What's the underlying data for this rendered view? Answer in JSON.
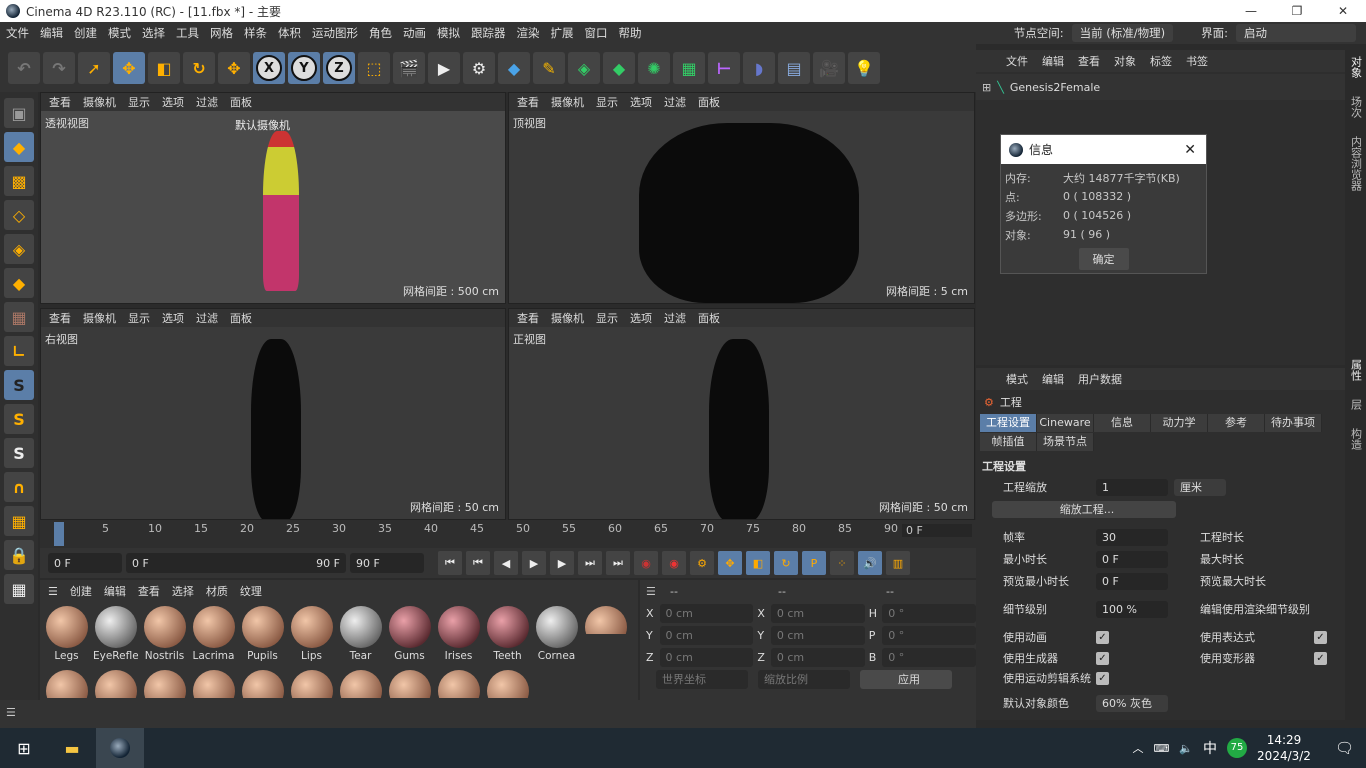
{
  "title": "Cinema 4D R23.110 (RC) - [11.fbx *] - 主要",
  "menu": [
    "文件",
    "编辑",
    "创建",
    "模式",
    "选择",
    "工具",
    "网格",
    "样条",
    "体积",
    "运动图形",
    "角色",
    "动画",
    "模拟",
    "跟踪器",
    "渲染",
    "扩展",
    "窗口",
    "帮助"
  ],
  "node_space": {
    "label": "节点空间:",
    "value": "当前 (标准/物理)"
  },
  "layout": {
    "label": "界面:",
    "value": "启动"
  },
  "toolbar_axes": [
    "X",
    "Y",
    "Z"
  ],
  "viewport_menu": [
    "查看",
    "摄像机",
    "显示",
    "选项",
    "过滤",
    "面板"
  ],
  "viewports": [
    {
      "name": "透视视图",
      "camera": "默认摄像机",
      "grid": "网格间距 : 500 cm"
    },
    {
      "name": "顶视图",
      "grid": "网格间距 : 5 cm"
    },
    {
      "name": "右视图",
      "grid": "网格间距 : 50 cm"
    },
    {
      "name": "正视图",
      "grid": "网格间距 : 50 cm"
    }
  ],
  "timeline": {
    "ticks": [
      "0",
      "5",
      "10",
      "15",
      "20",
      "25",
      "30",
      "35",
      "40",
      "45",
      "50",
      "55",
      "60",
      "65",
      "70",
      "75",
      "80",
      "85",
      "90"
    ],
    "current": "0 F",
    "start": "0 F",
    "range_start": "0 F",
    "range_end": "90 F",
    "end": "90 F",
    "end_right": "0 F"
  },
  "material_menu": [
    "创建",
    "编辑",
    "查看",
    "选择",
    "材质",
    "纹理"
  ],
  "materials": [
    "Legs",
    "EyeRefle",
    "Nostrils",
    "Lacrima",
    "Pupils",
    "Lips",
    "Tear",
    "Gums",
    "Irises",
    "Teeth",
    "Cornea"
  ],
  "coord": {
    "headers": [
      "--",
      "--",
      "--"
    ],
    "rows": [
      [
        "X",
        "0 cm",
        "X",
        "0 cm",
        "H",
        "0 °"
      ],
      [
        "Y",
        "0 cm",
        "Y",
        "0 cm",
        "P",
        "0 °"
      ],
      [
        "Z",
        "0 cm",
        "Z",
        "0 cm",
        "B",
        "0 °"
      ]
    ],
    "mode": "世界坐标",
    "scale": "缩放比例",
    "apply": "应用"
  },
  "object_manager": {
    "menu": [
      "文件",
      "编辑",
      "查看",
      "对象",
      "标签",
      "书签"
    ],
    "object": "Genesis2Female"
  },
  "side_tabs_top": [
    "对象",
    "场次",
    "内容浏览器"
  ],
  "side_tabs_bottom": [
    "属性",
    "层",
    "构造"
  ],
  "info_dialog": {
    "title": "信息",
    "rows": [
      [
        "内存:",
        "大约 14877千字节(KB)"
      ],
      [
        "点:",
        "0 ( 108332 )"
      ],
      [
        "多边形:",
        "0 ( 104526 )"
      ],
      [
        "对象:",
        "91 ( 96 )"
      ]
    ],
    "ok": "确定"
  },
  "attributes": {
    "menu": [
      "模式",
      "编辑",
      "用户数据"
    ],
    "object": "工程",
    "tabs": [
      "工程设置",
      "Cineware",
      "信息",
      "动力学",
      "参考",
      "待办事项",
      "帧插值",
      "场景节点"
    ],
    "section": "工程设置",
    "scale_label": "工程缩放",
    "scale_value": "1",
    "unit": "厘米",
    "scale_button": "缩放工程...",
    "fps_label": "帧率",
    "fps": "30",
    "min_label": "最小时长",
    "min": "0 F",
    "pmin_label": "预览最小时长",
    "pmin": "0 F",
    "dur_label": "工程时长",
    "max_label": "最大时长",
    "pmax_label": "预览最大时长",
    "lod_label": "细节级别",
    "lod": "100 %",
    "lod_render": "编辑使用渲染细节级别",
    "checks": [
      "使用动画",
      "使用生成器",
      "使用运动剪辑系统",
      "使用表达式",
      "使用变形器"
    ],
    "color_label": "默认对象颜色",
    "color_value": "60% 灰色"
  },
  "taskbar": {
    "time": "14:29",
    "date": "2024/3/2",
    "ime": "中",
    "badge": "75"
  }
}
